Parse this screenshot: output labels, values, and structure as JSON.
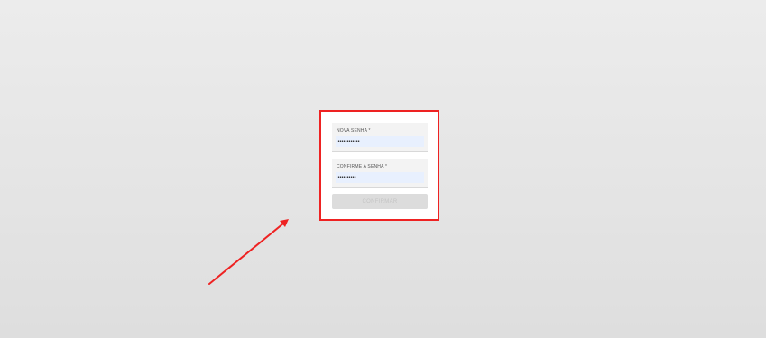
{
  "form": {
    "new_password_label": "NOVA SENHA *",
    "new_password_value": "••••••••••••",
    "confirm_password_label": "CONFIRME A SENHA *",
    "confirm_password_value": "••••••••••",
    "confirm_button_label": "CONFIRMAR",
    "confirm_button_state": "disabled"
  },
  "annotation": {
    "highlight_color": "#ee2222",
    "arrow_color": "#ee2222"
  }
}
